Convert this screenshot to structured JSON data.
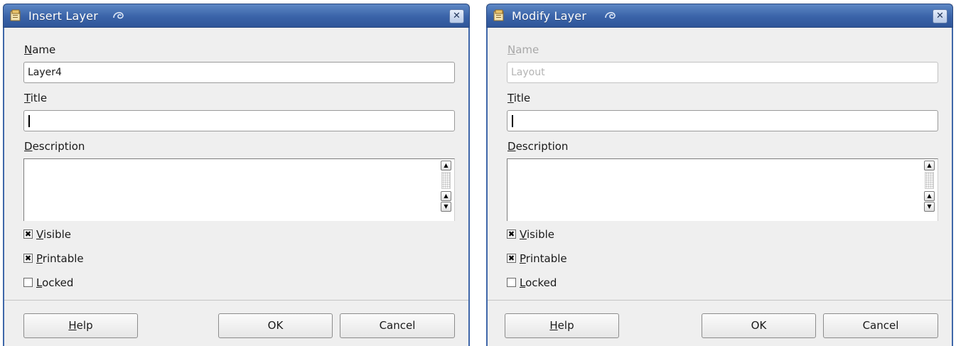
{
  "dialogs": [
    {
      "title": "Insert Layer",
      "name_label_first": "N",
      "name_label_rest": "ame",
      "name_value": "Layer4",
      "title_label_first": "T",
      "title_label_rest": "itle",
      "title_value": "",
      "description_label_first": "D",
      "description_label_rest": "escription",
      "description_value": "",
      "visible_first": "V",
      "visible_rest": "isible",
      "visible_checked": true,
      "printable_first": "P",
      "printable_rest": "rintable",
      "printable_checked": true,
      "locked_first": "L",
      "locked_rest": "ocked",
      "locked_checked": false,
      "help_first": "H",
      "help_rest": "elp",
      "ok_label": "OK",
      "cancel_label": "Cancel"
    },
    {
      "title": "Modify Layer",
      "name_label_first": "N",
      "name_label_rest": "ame",
      "name_value": "Layout",
      "name_disabled": true,
      "title_label_first": "T",
      "title_label_rest": "itle",
      "title_value": "",
      "description_label_first": "D",
      "description_label_rest": "escription",
      "description_value": "",
      "visible_first": "V",
      "visible_rest": "isible",
      "visible_checked": true,
      "printable_first": "P",
      "printable_rest": "rintable",
      "printable_checked": true,
      "locked_first": "L",
      "locked_rest": "ocked",
      "locked_checked": false,
      "help_first": "H",
      "help_rest": "elp",
      "ok_label": "OK",
      "cancel_label": "Cancel"
    }
  ],
  "icons": {
    "title_icon": "app-document-icon",
    "title_decoration": "swirl-icon",
    "close": "close-icon",
    "scroll_up": "arrow-up-icon",
    "scroll_down": "arrow-down-icon",
    "check_mark": "✖"
  },
  "colors": {
    "titlebar": "#3a63a8",
    "dialog_bg": "#efefef",
    "disabled_text": "#a8a8a8"
  }
}
